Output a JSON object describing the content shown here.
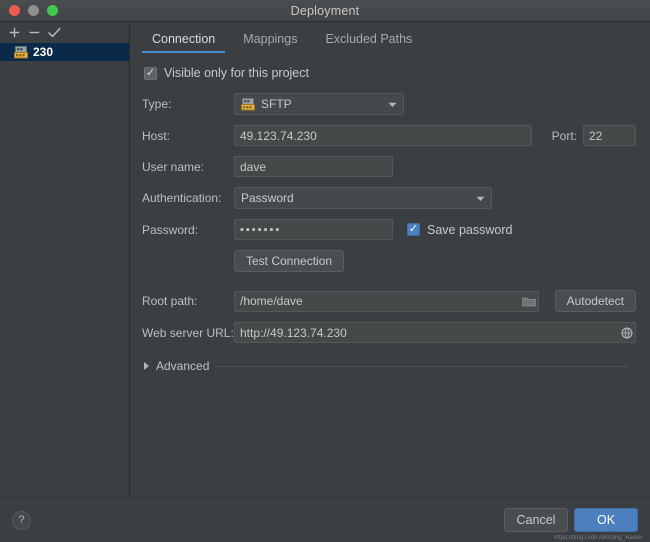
{
  "window": {
    "title": "Deployment",
    "traffic_lights": [
      "close-red",
      "minimize-gray",
      "zoom-green"
    ]
  },
  "sidebar": {
    "toolbar": [
      {
        "name": "add",
        "glyph": "+"
      },
      {
        "name": "remove",
        "glyph": "−"
      },
      {
        "name": "set-default",
        "glyph": "✓"
      }
    ],
    "items": [
      {
        "label": "230",
        "icon": "sftp-server-icon",
        "selected": true
      }
    ]
  },
  "tabs": [
    {
      "label": "Connection",
      "active": true
    },
    {
      "label": "Mappings",
      "active": false
    },
    {
      "label": "Excluded Paths",
      "active": false
    }
  ],
  "form": {
    "visible_only": {
      "label": "Visible only for this project",
      "checked": true
    },
    "type": {
      "label": "Type:",
      "value": "SFTP",
      "icon": "sftp-server-icon"
    },
    "host": {
      "label": "Host:",
      "value": "49.123.74.230"
    },
    "port": {
      "label": "Port:",
      "value": "22"
    },
    "username": {
      "label": "User name:",
      "value": "dave"
    },
    "authentication": {
      "label": "Authentication:",
      "value": "Password"
    },
    "password": {
      "label": "Password:",
      "value": "▪▪▪▪▪▪▪"
    },
    "save_password": {
      "label": "Save password",
      "checked": true
    },
    "test_connection": {
      "label": "Test Connection"
    },
    "root_path": {
      "label": "Root path:",
      "value": "/home/dave",
      "icon": "folder-browse-icon"
    },
    "autodetect": {
      "label": "Autodetect"
    },
    "web_server_url": {
      "label": "Web server URL:",
      "value": "http://49.123.74.230",
      "icon": "globe-icon"
    },
    "advanced": {
      "label": "Advanced",
      "expanded": false
    }
  },
  "footer": {
    "help": "?",
    "cancel": "Cancel",
    "ok": "OK",
    "watermark": "https://blog.csdn.net/Ding_xiaolei"
  },
  "colors": {
    "accent": "#4b7fbe",
    "window_bg": "#3c3f41",
    "field_bg": "#45494a",
    "selection_bg": "#0b2948"
  }
}
